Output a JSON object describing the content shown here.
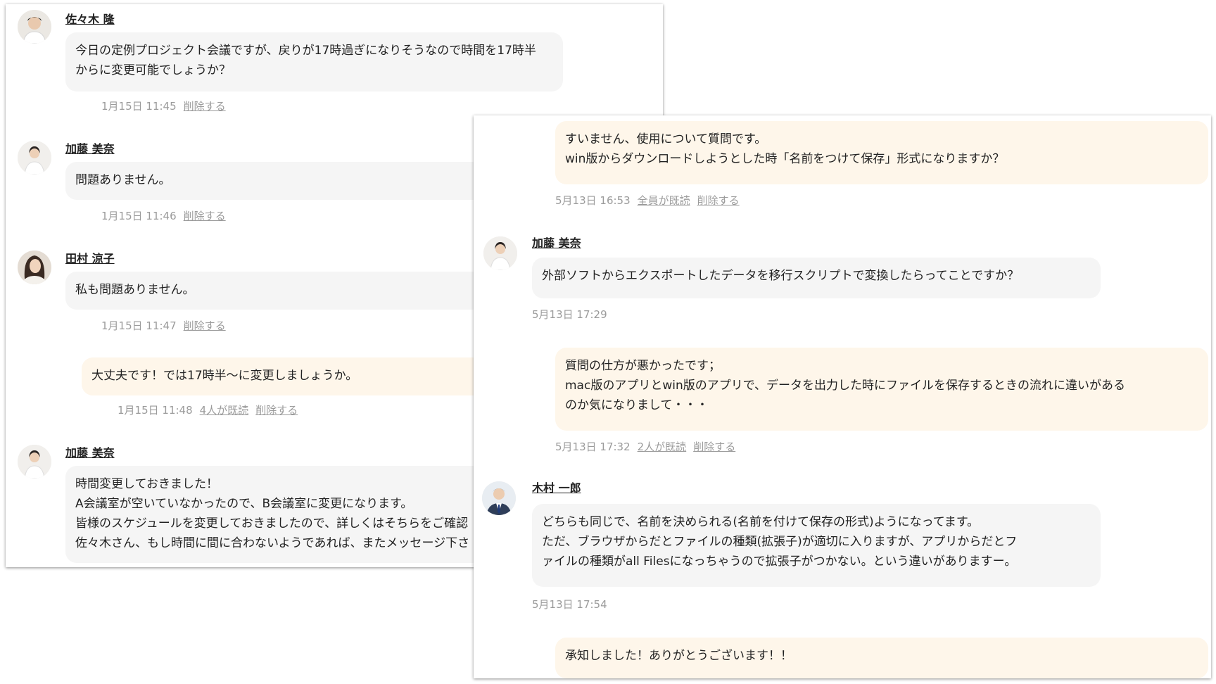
{
  "left_chat": {
    "messages": [
      {
        "sender": "佐々木 隆",
        "avatar_icon": "avatar-man-icon",
        "lines": [
          "今日の定例プロジェクト会議ですが、戻りが17時過ぎになりそうなので時間を17時半",
          "からに変更可能でしょうか？"
        ],
        "timestamp": "1月15日 11:45",
        "delete_label": "削除する"
      },
      {
        "sender": "加藤 美奈",
        "avatar_icon": "avatar-woman-icon",
        "lines": [
          "問題ありません。"
        ],
        "timestamp": "1月15日 11:46",
        "delete_label": "削除する"
      },
      {
        "sender": "田村 涼子",
        "avatar_icon": "avatar-woman-icon",
        "lines": [
          "私も問題ありません。"
        ],
        "timestamp": "1月15日 11:47",
        "delete_label": "削除する"
      },
      {
        "own": true,
        "lines": [
          "大丈夫です！では17時半〜に変更しましょうか。"
        ],
        "timestamp": "1月15日 11:48",
        "read_label": "4人が既読",
        "delete_label": "削除する"
      },
      {
        "sender": "加藤 美奈",
        "avatar_icon": "avatar-woman-icon",
        "lines": [
          "時間変更しておきました！",
          "A会議室が空いていなかったので、B会議室に変更になります。",
          "皆様のスケジュールを変更しておきましたので、詳しくはそちらをご確認",
          "佐々木さん、もし時間に間に合わないようであれば、またメッセージ下さ"
        ]
      }
    ]
  },
  "right_chat": {
    "messages": [
      {
        "own": true,
        "lines": [
          "すいません、使用について質問です。",
          "win版からダウンロードしようとした時「名前をつけて保存」形式になりますか？"
        ],
        "timestamp": "5月13日 16:53",
        "read_label": "全員が既読",
        "delete_label": "削除する"
      },
      {
        "sender": "加藤 美奈",
        "avatar_icon": "avatar-woman-icon",
        "lines": [
          "外部ソフトからエクスポートしたデータを移行スクリプトで変換したらってことですか？"
        ],
        "timestamp": "5月13日 17:29"
      },
      {
        "own": true,
        "lines": [
          "質問の仕方が悪かったです；",
          "mac版のアプリとwin版のアプリで、データを出力した時にファイルを保存するときの流れに違いがある",
          "のか気になりまして・・・"
        ],
        "timestamp": "5月13日 17:32",
        "read_label": "2人が既読",
        "delete_label": "削除する"
      },
      {
        "sender": "木村 一郎",
        "avatar_icon": "avatar-man-suit-icon",
        "lines": [
          "どちらも同じで、名前を決められる(名前を付けて保存の形式)ようになってます。",
          "ただ、ブラウザからだとファイルの種類(拡張子)が適切に入りますが、アプリからだとフ",
          "ァイルの種類がall Filesになっちゃうので拡張子がつかない。という違いがありますー。"
        ],
        "timestamp": "5月13日 17:54"
      },
      {
        "own": true,
        "lines": [
          "承知しました！ありがとうございます！！"
        ]
      }
    ]
  },
  "colors": {
    "other_bubble": "#f5f5f5",
    "own_bubble": "#fef6ea",
    "meta_text": "#9b9b9b"
  }
}
